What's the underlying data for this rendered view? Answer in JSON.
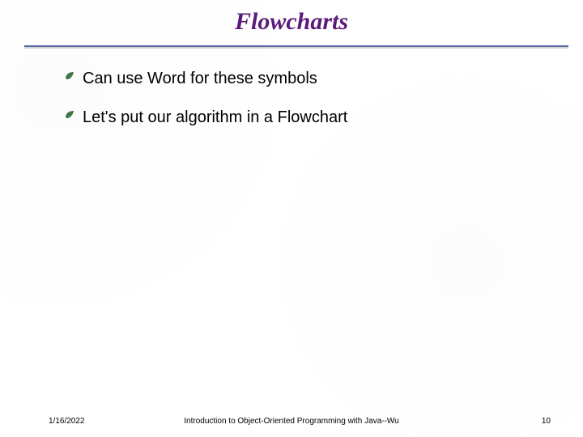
{
  "title": "Flowcharts",
  "bullets": [
    {
      "text": "Can use Word for these symbols"
    },
    {
      "text": "Let's put our algorithm in a Flowchart"
    }
  ],
  "footer": {
    "date": "1/16/2022",
    "center": "Introduction to Object-Oriented Programming with Java--Wu",
    "page": "10"
  },
  "colors": {
    "title": "#5a1a7a",
    "rule": "#5d6aa8",
    "bullet": "#3a6a3a"
  }
}
